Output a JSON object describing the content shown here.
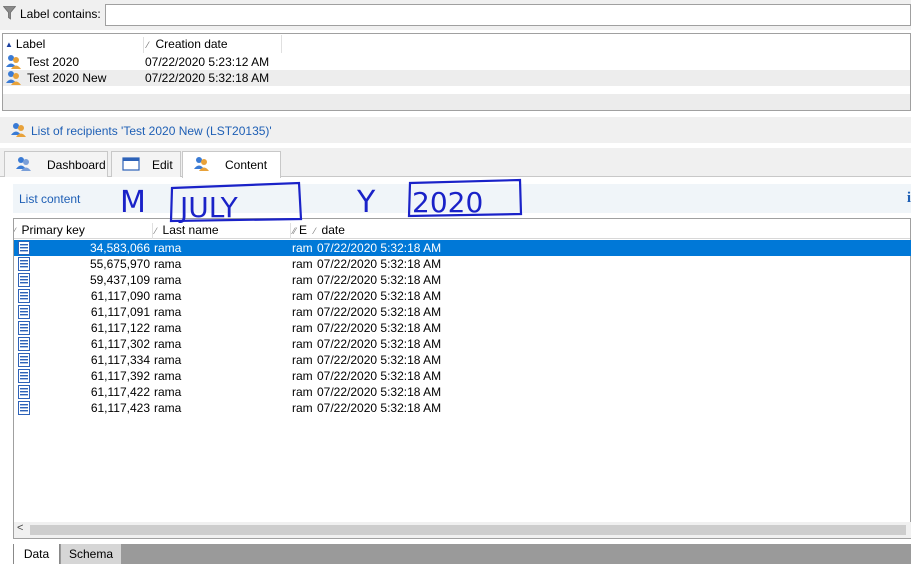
{
  "filter": {
    "label": "Label contains:",
    "value": "",
    "placeholder": ""
  },
  "list": {
    "columns": {
      "label": "Label",
      "creation_date": "Creation date"
    },
    "rows": [
      {
        "label": "Test 2020",
        "date": "07/22/2020 5:23:12 AM"
      },
      {
        "label": "Test 2020 New",
        "date": "07/22/2020 5:32:18 AM"
      }
    ]
  },
  "detail": {
    "title": "List of recipients 'Test 2020 New (LST20135)'",
    "tabs": [
      {
        "label": "Dashboard",
        "icon": "dashboard-icon"
      },
      {
        "label": "Edit",
        "icon": "window-icon"
      },
      {
        "label": "Content",
        "icon": "users-icon"
      }
    ],
    "active_tab": "Content",
    "content_link": "List content",
    "info_glyph": "i"
  },
  "grid": {
    "columns": {
      "primary_key": "Primary key",
      "last_name": "Last name",
      "email": "E",
      "date": "date"
    },
    "rows": [
      {
        "pk": "34,583,066",
        "ln": "rama",
        "em": "ram",
        "dt": "07/22/2020 5:32:18 AM"
      },
      {
        "pk": "55,675,970",
        "ln": "rama",
        "em": "ram",
        "dt": "07/22/2020 5:32:18 AM"
      },
      {
        "pk": "59,437,109",
        "ln": "rama",
        "em": "ram",
        "dt": "07/22/2020 5:32:18 AM"
      },
      {
        "pk": "61,117,090",
        "ln": "rama",
        "em": "ram",
        "dt": "07/22/2020 5:32:18 AM"
      },
      {
        "pk": "61,117,091",
        "ln": "rama",
        "em": "ram",
        "dt": "07/22/2020 5:32:18 AM"
      },
      {
        "pk": "61,117,122",
        "ln": "rama",
        "em": "ram",
        "dt": "07/22/2020 5:32:18 AM"
      },
      {
        "pk": "61,117,302",
        "ln": "rama",
        "em": "ram",
        "dt": "07/22/2020 5:32:18 AM"
      },
      {
        "pk": "61,117,334",
        "ln": "rama",
        "em": "ram",
        "dt": "07/22/2020 5:32:18 AM"
      },
      {
        "pk": "61,117,392",
        "ln": "rama",
        "em": "ram",
        "dt": "07/22/2020 5:32:18 AM"
      },
      {
        "pk": "61,117,422",
        "ln": "rama",
        "em": "ram",
        "dt": "07/22/2020 5:32:18 AM"
      },
      {
        "pk": "61,117,423",
        "ln": "rama",
        "em": "ram",
        "dt": "07/22/2020 5:32:18 AM"
      }
    ],
    "selected_row": 0
  },
  "bottom_tabs": [
    {
      "label": "Data"
    },
    {
      "label": "Schema"
    }
  ],
  "annotations": {
    "m_text": "M",
    "month_text": "JULY",
    "y_text": "Y",
    "year_text": "2020",
    "color": "#1a22c8"
  },
  "colors": {
    "accent": "#1e5fb5",
    "selection": "#0078d7"
  }
}
